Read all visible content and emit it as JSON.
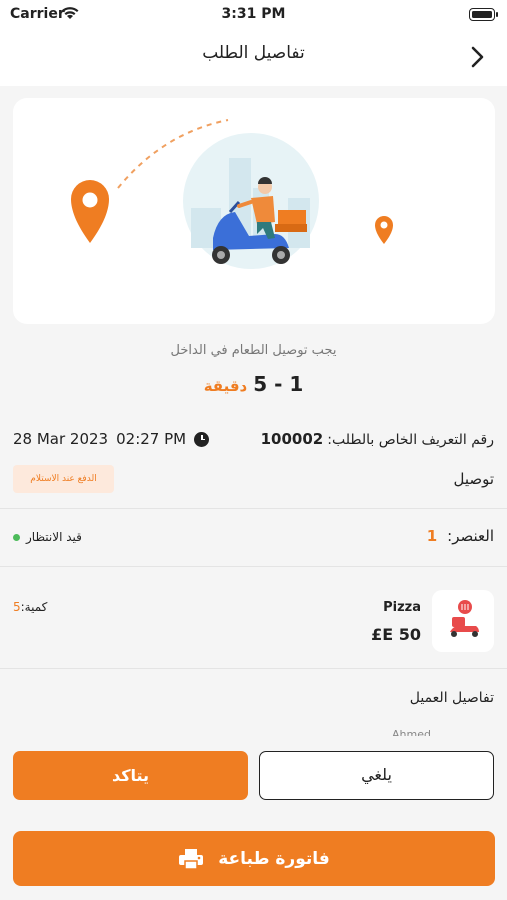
{
  "status_bar": {
    "carrier": "Carrier",
    "time": "3:31 PM"
  },
  "nav": {
    "title": "تفاصيل الطلب"
  },
  "estimate": {
    "label": "يجب توصيل الطعام في الداخل",
    "range": "1 - 5",
    "unit": "دقيقة"
  },
  "order": {
    "id_label": "رقم التعريف الخاص بالطلب:",
    "id": "100002",
    "date": "28 Mar 2023",
    "time": "02:27 PM",
    "payment_badge": "الدفع عند الاستلام",
    "delivery_type": "توصيل",
    "items_label": "العنصر:",
    "items_count": "1",
    "status": "قيد الانتظار"
  },
  "product": {
    "name": "Pizza",
    "price": "£E 50",
    "qty_label": "كمية:",
    "qty": "5"
  },
  "customer": {
    "title": "تفاصيل العميل",
    "name": "Ahmed"
  },
  "actions": {
    "cancel": "يلغي",
    "confirm": "يتاكد",
    "print": "فاتورة طباعة"
  },
  "colors": {
    "accent": "#ef7d22",
    "status_dot": "#4cbb5a",
    "badge_bg": "#fde9dc"
  }
}
